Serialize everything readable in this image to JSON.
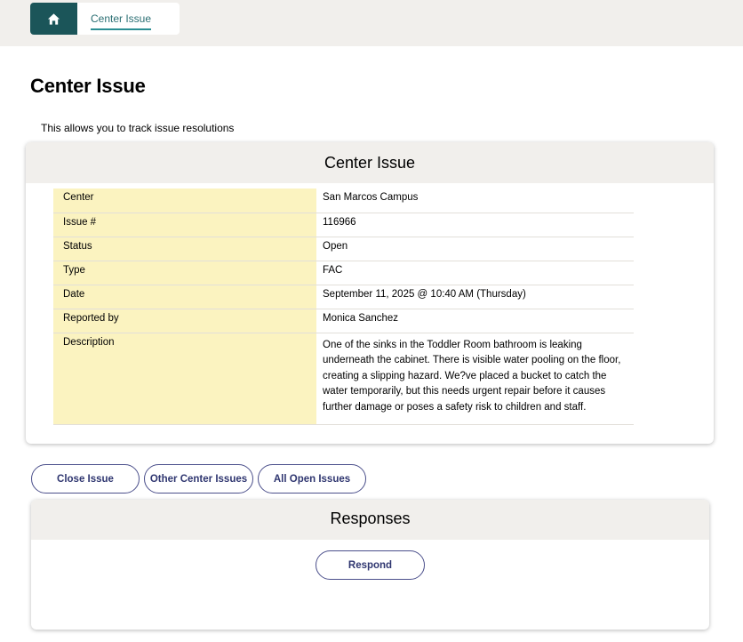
{
  "breadcrumb": {
    "current": "Center Issue"
  },
  "page": {
    "title": "Center Issue",
    "description": "This allows you to track issue resolutions"
  },
  "issue_card": {
    "title": "Center Issue",
    "rows": [
      {
        "label": "Center",
        "value": "San Marcos Campus"
      },
      {
        "label": "Issue #",
        "value": "116966"
      },
      {
        "label": "Status",
        "value": "Open"
      },
      {
        "label": "Type",
        "value": "FAC"
      },
      {
        "label": "Date",
        "value": "September 11, 2025 @ 10:40 AM (Thursday)"
      },
      {
        "label": "Reported by",
        "value": "Monica Sanchez"
      },
      {
        "label": "Description",
        "value": "One of the sinks in the Toddler Room bathroom is leaking underneath the cabinet. There is visible water pooling on the floor, creating a slipping hazard. We?ve placed a bucket to catch the water temporarily, but this needs urgent repair before it causes further damage or poses a safety risk to children and staff."
      }
    ]
  },
  "actions": {
    "close_issue": "Close Issue",
    "other_center_issues": "Other Center Issues",
    "all_open_issues": "All Open Issues"
  },
  "responses": {
    "title": "Responses",
    "respond_label": "Respond"
  },
  "colors": {
    "accent": "#1b5559",
    "header_bg": "#f1efec",
    "label_bg": "#fbf3c0",
    "button_text": "#2f3670"
  },
  "icons": {
    "home": "home-icon"
  }
}
